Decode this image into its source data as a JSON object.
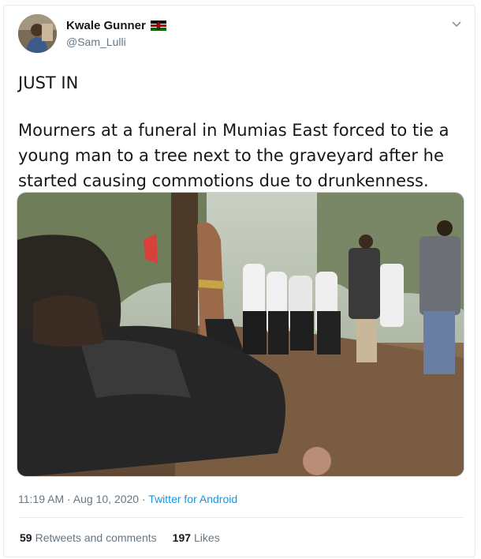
{
  "author": {
    "name": "Kwale Gunner",
    "handle": "@Sam_Lulli",
    "avatar_icon": "profile-photo",
    "flag_icon": "kenya-flag-icon"
  },
  "tweet": {
    "line1": "JUST IN",
    "body": "Mourners at a funeral in Mumias East forced to tie a young man to a tree next to the graveyard after he started causing commotions due to drunkenness.",
    "photo_icon": "attached-photo"
  },
  "meta": {
    "time": "11:19 AM",
    "separator": " · ",
    "date": "Aug 10, 2020",
    "source": "Twitter for Android"
  },
  "stats": {
    "retweets_count": "59",
    "retweets_label": "Retweets and comments",
    "likes_count": "197",
    "likes_label": "Likes"
  },
  "colors": {
    "link": "#1b95e0",
    "secondary_text": "#657786",
    "border": "#e6ecf0"
  }
}
